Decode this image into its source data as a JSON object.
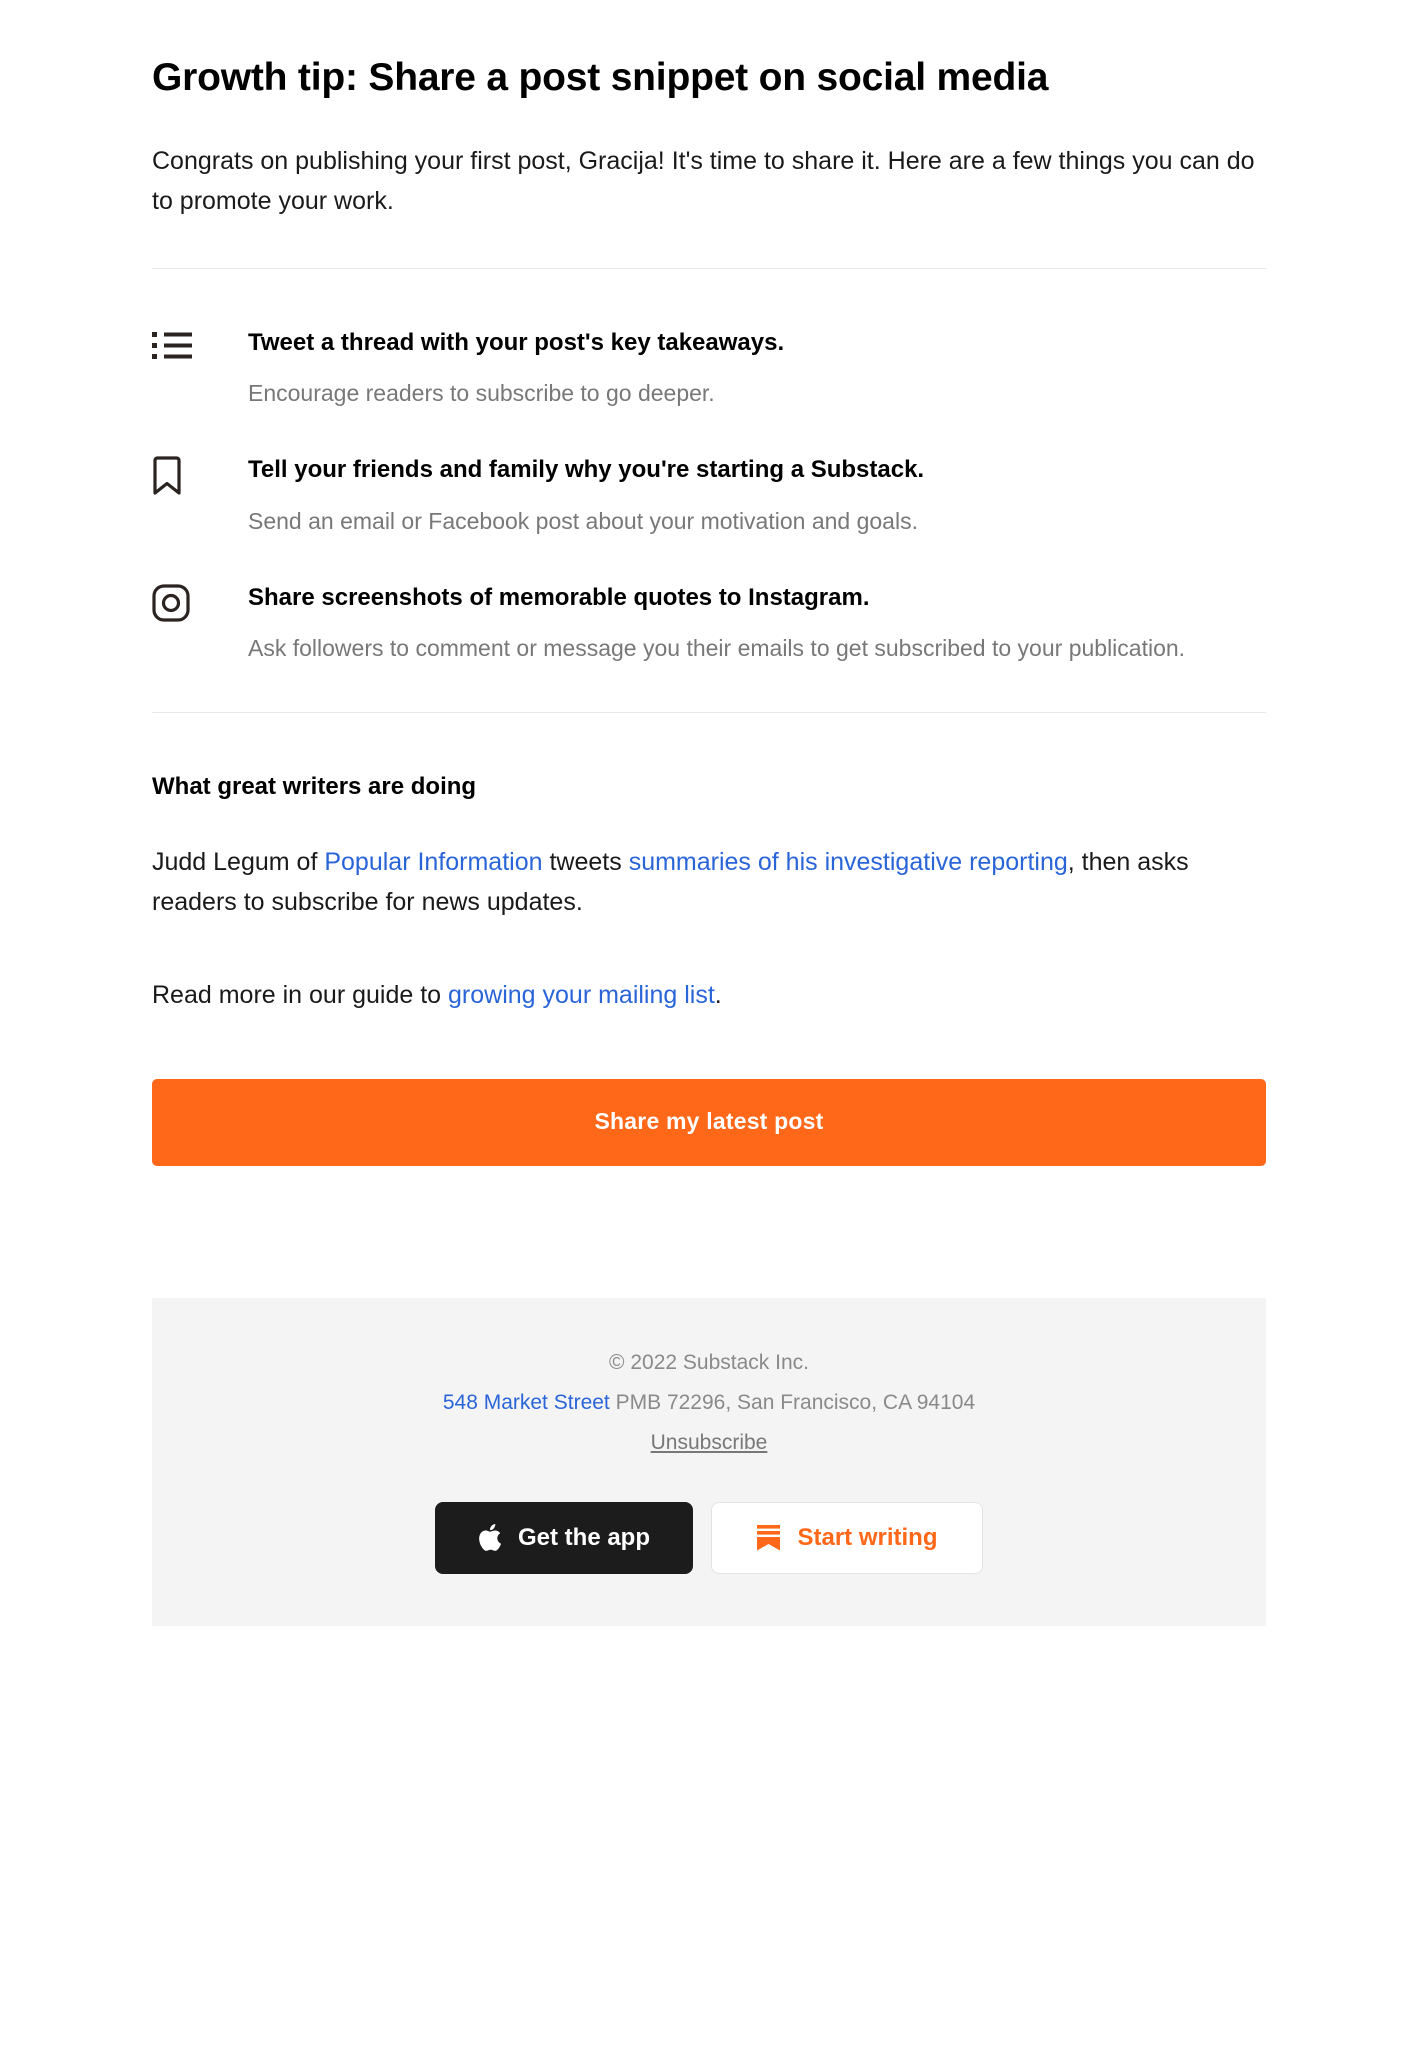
{
  "email": {
    "title": "Growth tip: Share a post snippet on social media",
    "intro": "Congrats on publishing your first post, Gracija! It's time to share it. Here are a few things you can do to promote your work.",
    "tips": [
      {
        "icon": "list-icon",
        "title": "Tweet a thread with your post's key takeaways.",
        "description": "Encourage readers to subscribe to go deeper."
      },
      {
        "icon": "bookmark-icon",
        "title": "Tell your friends and family why you're starting a Substack.",
        "description": "Send an email or Facebook post about your motivation and goals."
      },
      {
        "icon": "instagram-camera-icon",
        "title": "Share screenshots of memorable quotes to Instagram.",
        "description": "Ask followers to comment or message you their emails to get subscribed to your publication."
      }
    ],
    "writers": {
      "heading": "What great writers are doing",
      "paragraph1": {
        "part1": "Judd Legum of ",
        "link1": "Popular Information",
        "part2": " tweets ",
        "link2": "summaries of his investigative reporting",
        "part3": ", then asks readers to subscribe for news updates."
      },
      "paragraph2": {
        "part1": "Read more in our guide to ",
        "link1": "growing your mailing list",
        "part2": "."
      }
    },
    "cta": {
      "label": "Share my latest post",
      "color": "#ff6719"
    },
    "footer": {
      "copyright": "© 2022 Substack Inc.",
      "address_link": "548 Market Street",
      "address_rest": " PMB 72296, San Francisco, CA 94104",
      "unsubscribe": "Unsubscribe",
      "get_app_label": "Get the app",
      "get_app_icon": "apple-logo-icon",
      "start_writing_label": "Start writing",
      "start_writing_icon": "substack-logo-icon"
    }
  },
  "colors": {
    "accent": "#ff6719",
    "link": "#2a65d8",
    "muted_text": "#787878",
    "footer_bg": "#f4f4f4",
    "rule": "#e8e8e8"
  }
}
